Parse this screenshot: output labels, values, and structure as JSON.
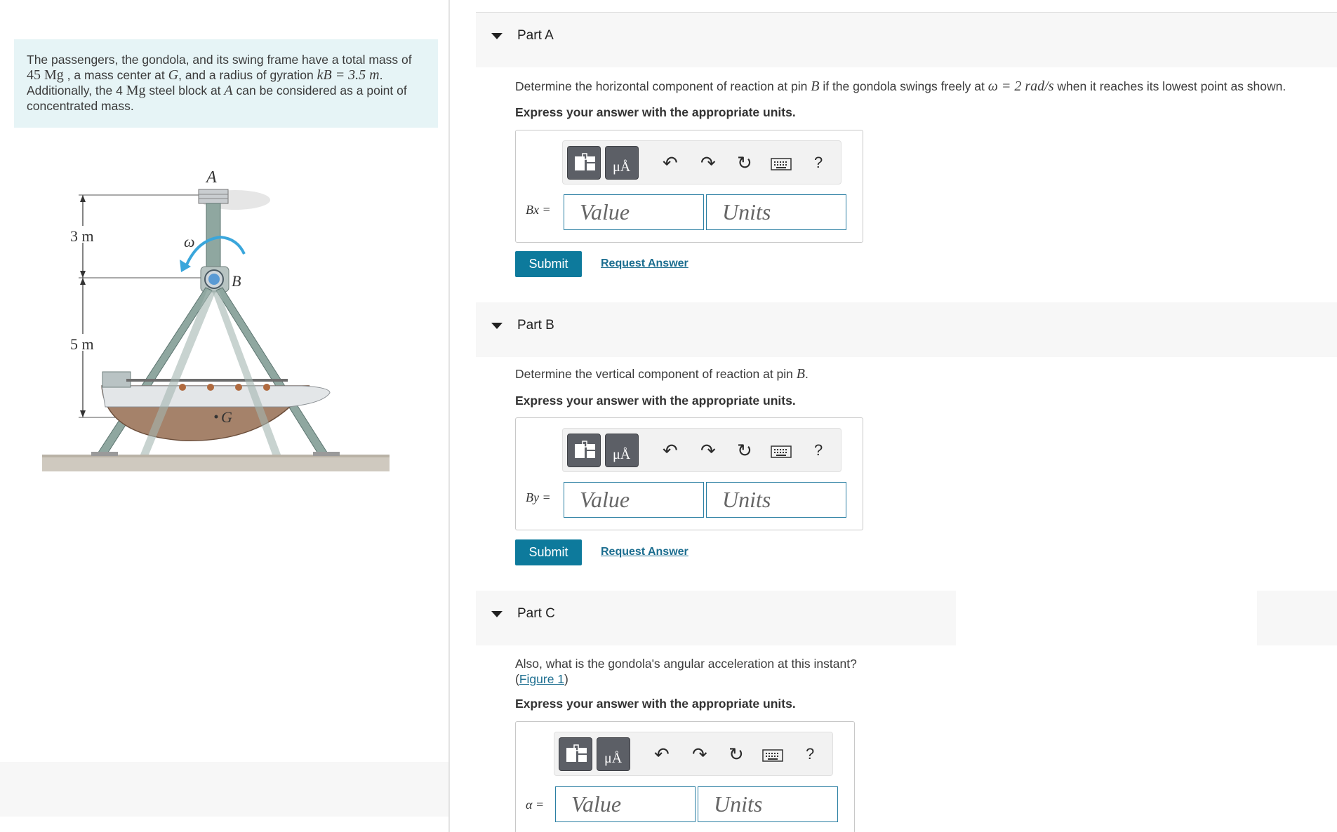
{
  "problem": {
    "text_1": "The passengers, the gondola, and its swing frame have a total mass of",
    "mass_value": "45 Mg",
    "text_2": ", a mass center at",
    "G": "G",
    "text_3": ", and a radius of gyration",
    "kB": "kB = 3.5 m",
    "text_4": ".",
    "text_5": "Additionally, the 4",
    "Mg": "Mg",
    "text_6": "steel block at",
    "A": "A",
    "text_7": "can be considered as a point of concentrated mass."
  },
  "figure": {
    "label_A": "A",
    "label_B": "B",
    "label_G": "G",
    "label_omega": "ω",
    "dim_3m": "3 m",
    "dim_5m": "5 m"
  },
  "parts": [
    {
      "title": "Part A",
      "question_1": "Determine the horizontal component of reaction at pin",
      "question_var": "B",
      "question_2": "if the gondola swings freely at",
      "omega_expr": "ω = 2 rad/s",
      "question_3": "when it reaches its lowest point as shown.",
      "instruction": "Express your answer with the appropriate units.",
      "eq_label": "Bx =",
      "value_placeholder": "Value",
      "units_placeholder": "Units",
      "submit": "Submit",
      "request": "Request Answer"
    },
    {
      "title": "Part B",
      "question_1": "Determine the vertical component of reaction at pin",
      "question_var": "B",
      "question_end": ".",
      "instruction": "Express your answer with the appropriate units.",
      "eq_label": "By =",
      "value_placeholder": "Value",
      "units_placeholder": "Units",
      "submit": "Submit",
      "request": "Request Answer"
    },
    {
      "title": "Part C",
      "question_1": "Also, what is the gondola's angular acceleration at this instant?",
      "figure_link": "Figure 1",
      "instruction": "Express your answer with the appropriate units.",
      "eq_label": "α =",
      "value_placeholder": "Value",
      "units_placeholder": "Units"
    }
  ],
  "toolbar": {
    "units_glyph": "μÅ",
    "undo_glyph": "↶",
    "redo_glyph": "↷",
    "reset_glyph": "↻",
    "help_glyph": "?"
  },
  "colors": {
    "accent": "#0d7a9c",
    "link": "#1b6d8f",
    "problem_bg": "#e6f4f6",
    "header_bg": "#f7f7f7"
  }
}
